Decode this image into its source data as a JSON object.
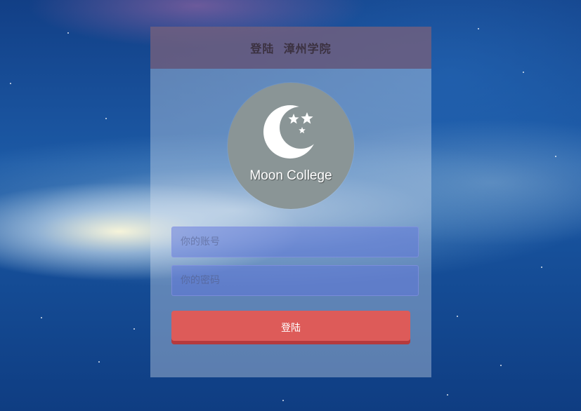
{
  "header": {
    "title": "登陆  漳州学院"
  },
  "logo": {
    "text": "Moon College",
    "icon": "moon-stars-icon"
  },
  "form": {
    "username": {
      "value": "",
      "placeholder": "你的账号"
    },
    "password": {
      "value": "",
      "placeholder": "你的密码"
    },
    "submit_label": "登陆"
  },
  "colors": {
    "header_bg": "#624c6e",
    "logo_circle": "#8a9596",
    "input_bg": "#5f76dc",
    "button_bg": "#dd5b59",
    "button_shadow": "#b53a3d"
  }
}
